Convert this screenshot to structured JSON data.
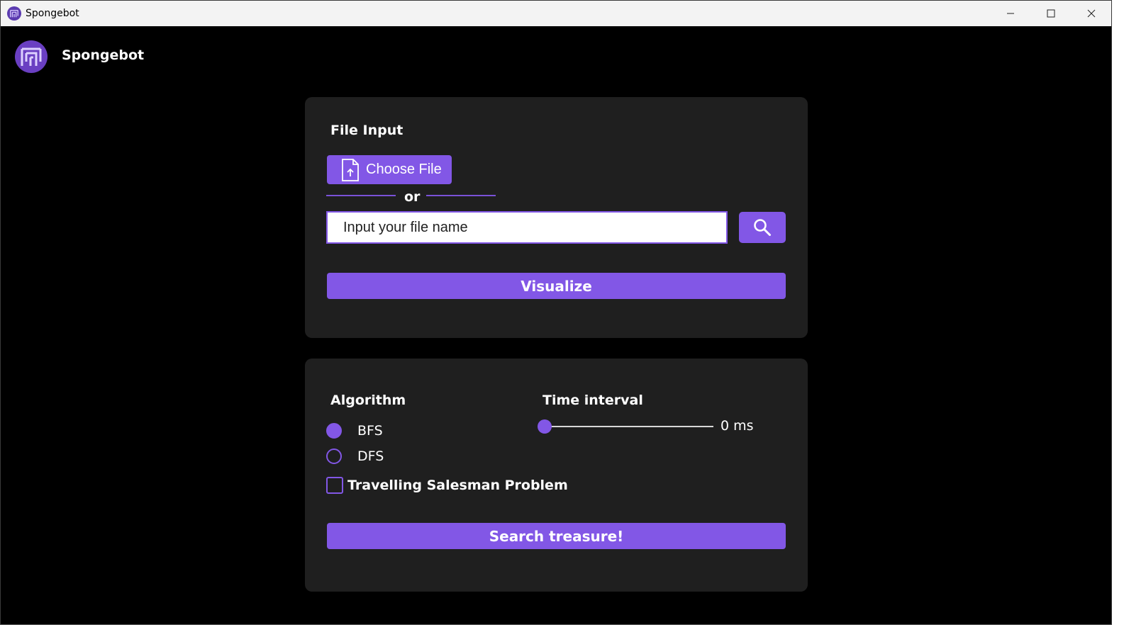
{
  "window": {
    "title": "Spongebot",
    "controls": [
      "minimize-icon",
      "maximize-icon",
      "close-icon"
    ]
  },
  "header": {
    "app_name": "Spongebot",
    "logo": "maze-logo-icon"
  },
  "colors": {
    "accent": "#8257e6",
    "card_bg": "#1f1f1f",
    "page_bg": "#000000",
    "titlebar_bg": "#f3f3f3"
  },
  "file_card": {
    "label": "File Input",
    "choose_file_label": "Choose File",
    "choose_file_icon": "file-upload-icon",
    "or_text": "or",
    "input_placeholder": "Input your file name",
    "input_value": "",
    "search_icon": "search-icon",
    "visualize_label": "Visualize"
  },
  "algo_card": {
    "algorithm_label": "Algorithm",
    "options": [
      {
        "label": "BFS",
        "checked": true
      },
      {
        "label": "DFS",
        "checked": false
      }
    ],
    "tsp_label": "Travelling Salesman Problem",
    "tsp_checked": false,
    "time_interval_label": "Time interval",
    "time_interval_value": 0,
    "time_interval_text": "0 ms",
    "search_label": "Search treasure!"
  }
}
